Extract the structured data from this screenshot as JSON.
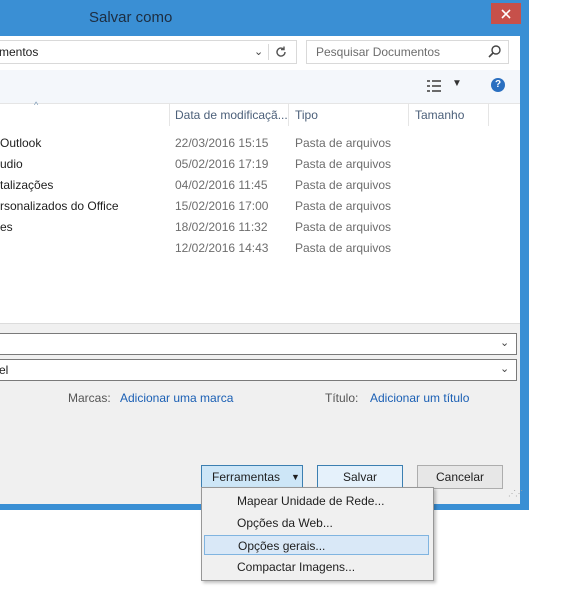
{
  "window": {
    "title": "Salvar como",
    "close_label": "✕"
  },
  "address": {
    "path": "mentos",
    "chevron": "⌄"
  },
  "search": {
    "placeholder": "Pesquisar Documentos"
  },
  "toolbar": {
    "view_icon": "view-list-icon",
    "help_label": "?"
  },
  "columns": {
    "date": "Data de modificaçã...",
    "type": "Tipo",
    "size": "Tamanho"
  },
  "files": [
    {
      "name": "Outlook",
      "date": "22/03/2016 15:15",
      "type": "Pasta de arquivos"
    },
    {
      "name": "udio",
      "date": "05/02/2016 17:19",
      "type": "Pasta de arquivos"
    },
    {
      "name": "talizações",
      "date": "04/02/2016 11:45",
      "type": "Pasta de arquivos"
    },
    {
      "name": "rsonalizados do Office",
      "date": "15/02/2016 17:00",
      "type": "Pasta de arquivos"
    },
    {
      "name": "es",
      "date": "18/02/2016 11:32",
      "type": "Pasta de arquivos"
    },
    {
      "name": "",
      "date": "12/02/2016 14:43",
      "type": "Pasta de arquivos"
    }
  ],
  "form": {
    "filename_value": "",
    "filetype_value": "el",
    "tags_label": "Marcas:",
    "tags_link": "Adicionar uma marca",
    "title_label": "Título:",
    "title_link": "Adicionar um título"
  },
  "buttons": {
    "tools": "Ferramentas",
    "save": "Salvar",
    "cancel": "Cancelar"
  },
  "tools_menu": [
    {
      "label": "Mapear Unidade de Rede..."
    },
    {
      "label": "Opções da Web..."
    },
    {
      "label": "Opções gerais..."
    },
    {
      "label": "Compactar Imagens..."
    }
  ],
  "colors": {
    "frame": "#3a8fd4",
    "close": "#c7504a",
    "link": "#1a5fb4",
    "highlight": "#d9e8f7"
  }
}
